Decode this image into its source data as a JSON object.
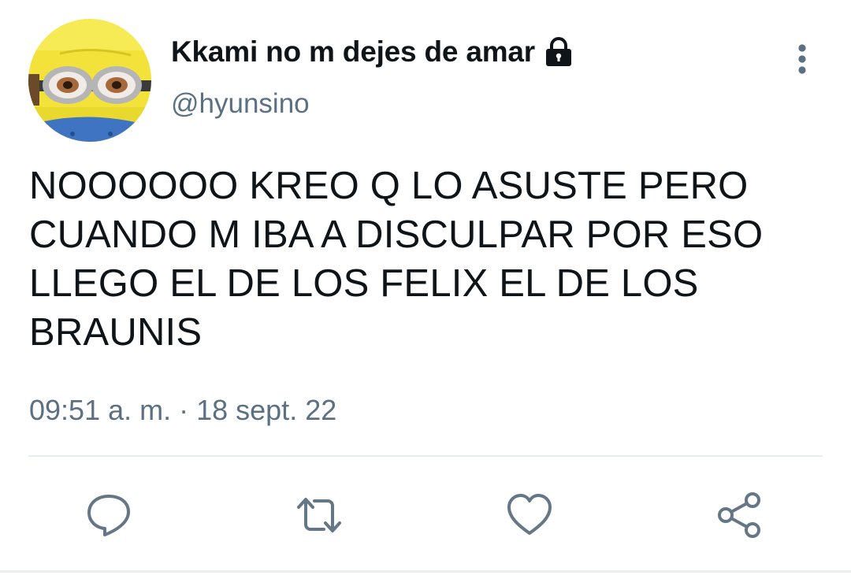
{
  "tweet": {
    "author": {
      "display_name": "Kkami no m dejes de amar",
      "handle": "@hyunsino",
      "avatar": "minion-avatar",
      "protected_icon": "lock-icon"
    },
    "text": "NOOOOOO KREO Q LO ASUSTE PERO\nCUANDO M IBA A DISCULPAR POR ESO\nLLEGO EL DE LOS FELIX EL DE LOS\nBRAUNIS",
    "timestamp": "09:51 a. m. · 18 sept. 22",
    "menu_icon": "more-vertical-icon"
  },
  "actions": [
    {
      "name": "reply",
      "icon": "reply-icon"
    },
    {
      "name": "retweet",
      "icon": "retweet-icon"
    },
    {
      "name": "like",
      "icon": "heart-icon"
    },
    {
      "name": "share",
      "icon": "share-icon"
    }
  ],
  "colors": {
    "text": "#0f1419",
    "secondary": "#5b7083",
    "icon": "#657786",
    "divider": "#e6ecf0"
  }
}
